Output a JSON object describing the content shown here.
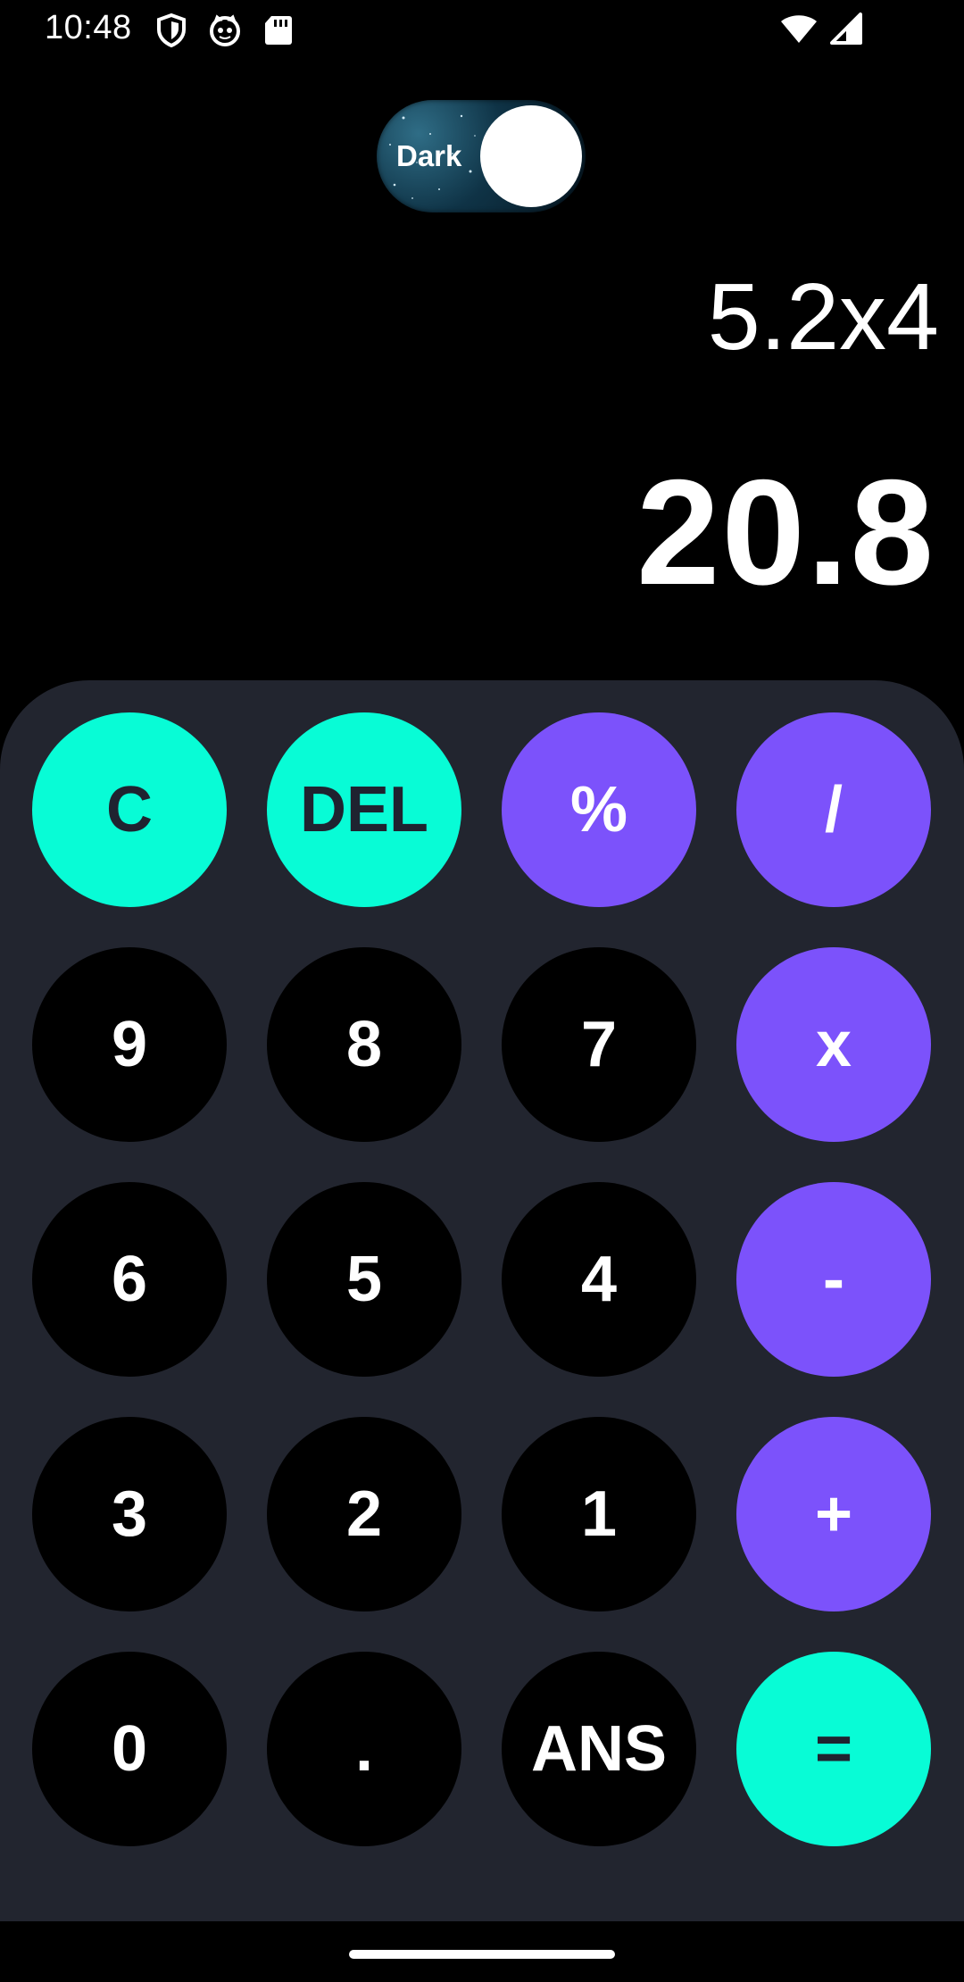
{
  "status_bar": {
    "time": "10:48",
    "icons": [
      "shield-icon",
      "cat-face-icon",
      "sd-card-icon",
      "wifi-icon",
      "signal-icon"
    ]
  },
  "theme_toggle": {
    "label": "Dark",
    "state": "on"
  },
  "display": {
    "expression": "5.2x4",
    "result": "20.8"
  },
  "keypad": {
    "keys": [
      {
        "label": "C",
        "style": "accent"
      },
      {
        "label": "DEL",
        "style": "accent"
      },
      {
        "label": "%",
        "style": "op"
      },
      {
        "label": "/",
        "style": "op"
      },
      {
        "label": "9",
        "style": "num"
      },
      {
        "label": "8",
        "style": "num"
      },
      {
        "label": "7",
        "style": "num"
      },
      {
        "label": "x",
        "style": "op"
      },
      {
        "label": "6",
        "style": "num"
      },
      {
        "label": "5",
        "style": "num"
      },
      {
        "label": "4",
        "style": "num"
      },
      {
        "label": "-",
        "style": "op"
      },
      {
        "label": "3",
        "style": "num"
      },
      {
        "label": "2",
        "style": "num"
      },
      {
        "label": "1",
        "style": "num"
      },
      {
        "label": "+",
        "style": "op"
      },
      {
        "label": "0",
        "style": "num"
      },
      {
        "label": ".",
        "style": "num"
      },
      {
        "label": "ANS",
        "style": "num"
      },
      {
        "label": "=",
        "style": "accent"
      }
    ]
  },
  "colors": {
    "background": "#000000",
    "keypad_background": "#22252f",
    "accent": "#08fcd6",
    "operator": "#7c52fb",
    "number_key": "#000000"
  }
}
